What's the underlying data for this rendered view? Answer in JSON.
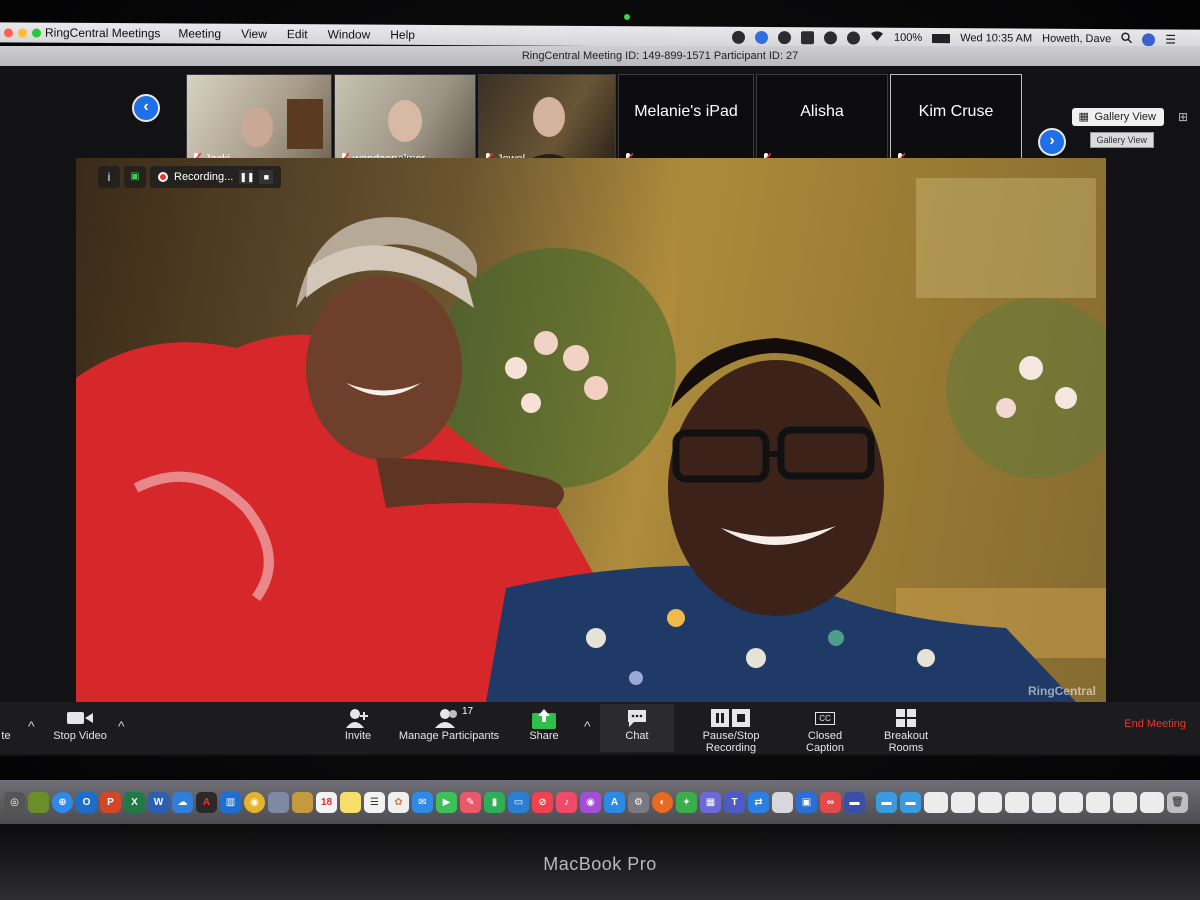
{
  "menubar": {
    "app_name": "RingCentral Meetings",
    "items": [
      "Meeting",
      "View",
      "Edit",
      "Window",
      "Help"
    ],
    "battery": "100%",
    "clock": "Wed 10:35 AM",
    "user": "Howeth, Dave"
  },
  "titlebar": {
    "title": "RingCentral Meeting ID: 149-899-1571 Participant ID: 27"
  },
  "gallery": {
    "participants": [
      {
        "name": "Jacki",
        "video": true
      },
      {
        "name": "wandaepalmer",
        "video": true
      },
      {
        "name": "Jewel",
        "video": true
      },
      {
        "name": "Melanie's iPad",
        "video": false
      },
      {
        "name": "Alisha",
        "video": false
      },
      {
        "name": "Kim Cruse",
        "video": false
      }
    ],
    "view_button": "Gallery View",
    "view_tooltip": "Gallery View"
  },
  "video": {
    "recording_label": "Recording...",
    "watermark": "RingCentral"
  },
  "controls": {
    "mute_label": "te",
    "stop_video": "Stop Video",
    "invite": "Invite",
    "manage_participants": "Manage Participants",
    "participant_count": "17",
    "share": "Share",
    "chat": "Chat",
    "pause_stop_recording": "Pause/Stop Recording",
    "closed_caption": "Closed Caption",
    "breakout_rooms": "Breakout Rooms",
    "end_meeting": "End Meeting"
  },
  "colors": {
    "accent_blue": "#1f6fe6",
    "share_green": "#2fbf4a",
    "end_red": "#e33333"
  },
  "bezel": {
    "brand": "MacBook Pro"
  }
}
